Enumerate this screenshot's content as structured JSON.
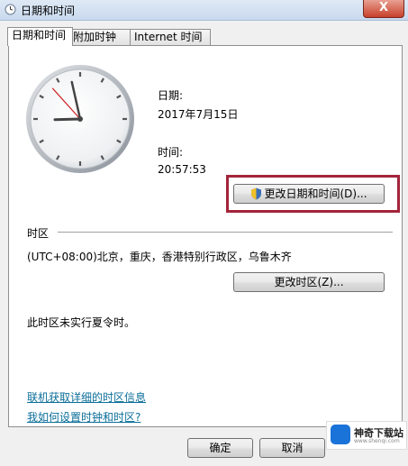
{
  "window": {
    "title": "日期和时间",
    "close_glyph": "X"
  },
  "tabs": [
    {
      "label": "日期和时间",
      "active": true
    },
    {
      "label": "附加时钟",
      "active": false
    },
    {
      "label": "Internet 时间",
      "active": false
    }
  ],
  "datetime": {
    "date_label": "日期:",
    "date_value": "2017年7月15日",
    "time_label": "时间:",
    "time_value": "20:57:53",
    "change_button": "更改日期和时间(D)..."
  },
  "timezone": {
    "section_label": "时区",
    "value": "(UTC+08:00)北京，重庆，香港特别行政区，乌鲁木齐",
    "change_button": "更改时区(Z)...",
    "dst_note": "此时区未实行夏令时。"
  },
  "links": {
    "online_info": "联机获取详细的时区信息",
    "how_to": "我如何设置时钟和时区?"
  },
  "footer": {
    "ok_button": "确定",
    "cancel_button": "取消"
  },
  "watermark": {
    "name": "神奇下载站",
    "sub": "www.shenqi.com"
  },
  "colors": {
    "highlight_border": "#a3243b",
    "link": "#0b6e99"
  }
}
